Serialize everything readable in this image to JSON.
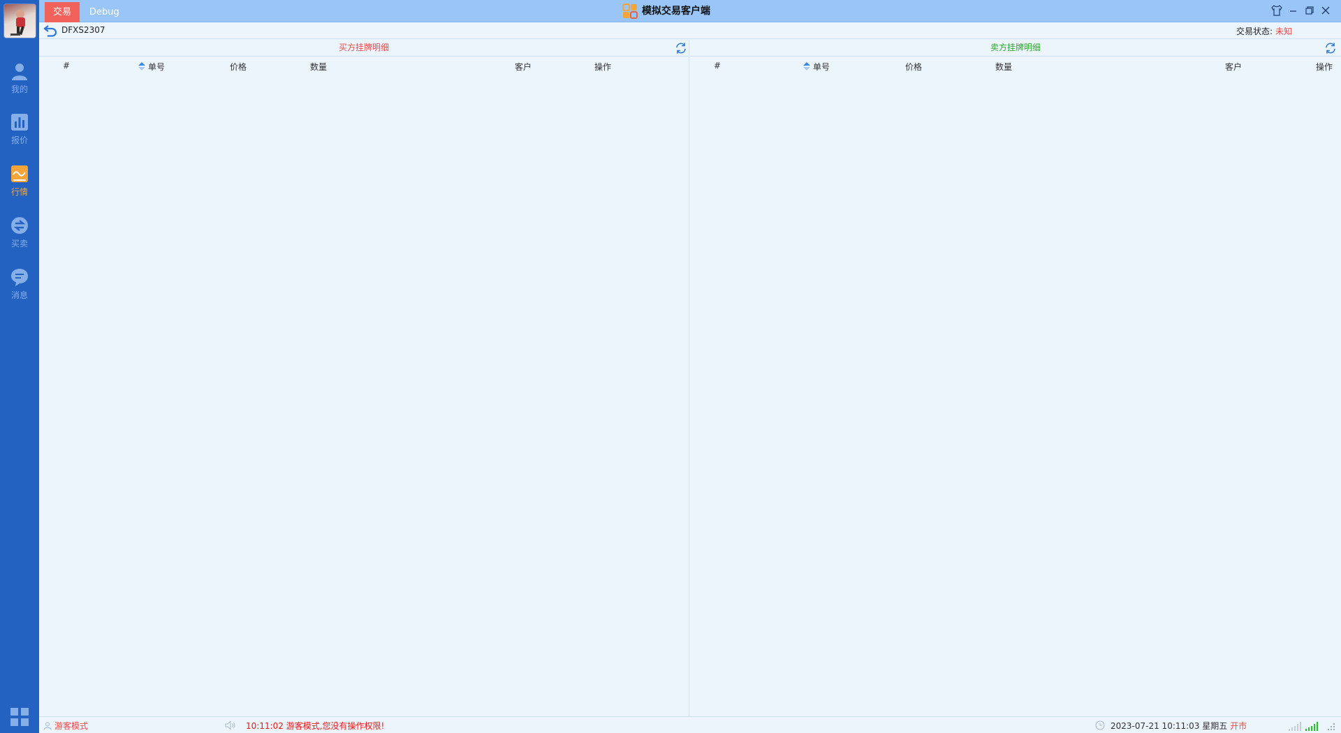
{
  "window": {
    "title": "模拟交易客户端",
    "tabs": [
      {
        "label": "交易",
        "active": true
      },
      {
        "label": "Debug",
        "active": false
      }
    ]
  },
  "sidebar": {
    "items": [
      {
        "label": "我的",
        "icon": "user-icon",
        "active": false
      },
      {
        "label": "报价",
        "icon": "bar-chart-icon",
        "active": false
      },
      {
        "label": "行情",
        "icon": "wave-icon",
        "active": true
      },
      {
        "label": "买卖",
        "icon": "trade-icon",
        "active": false
      },
      {
        "label": "消息",
        "icon": "chat-icon",
        "active": false
      }
    ]
  },
  "subheader": {
    "contract": "DFXS2307",
    "status_label": "交易状态:",
    "status_value": "未知"
  },
  "buy_panel": {
    "title": "买方挂牌明细",
    "columns": [
      "#",
      "单号",
      "价格",
      "数量",
      "客户",
      "操作"
    ],
    "rows": []
  },
  "sell_panel": {
    "title": "卖方挂牌明细",
    "columns": [
      "#",
      "单号",
      "价格",
      "数量",
      "客户",
      "操作"
    ],
    "rows": []
  },
  "statusbar": {
    "mode": "游客模式",
    "message": "10:11:02 游客模式,您没有操作权限!",
    "datetime": "2023-07-21 10:11:03 星期五",
    "market_state": "开市"
  },
  "colors": {
    "sidebar": "#2462c2",
    "titlebar": "#99c6f6",
    "active_tab": "#f0625a",
    "buy": "#e84d4d",
    "sell": "#2fa82f",
    "background": "#ecf4fc"
  }
}
